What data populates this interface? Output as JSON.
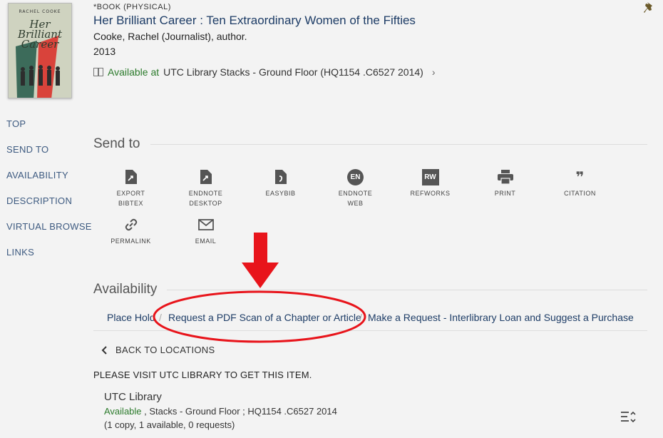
{
  "record": {
    "type": "*BOOK (PHYSICAL)",
    "title": "Her Brilliant Career : Ten Extraordinary Women of the Fifties",
    "author": "Cooke, Rachel (Journalist), author.",
    "year": "2013",
    "availability": {
      "status": "Available at",
      "location": "UTC Library  Stacks - Ground Floor (HQ1154 .C6527 2014)",
      "chevron": "›"
    },
    "cover": {
      "author": "RACHEL COOKE",
      "title": "Her Brilliant Career"
    }
  },
  "sidenav": [
    "TOP",
    "SEND TO",
    "AVAILABILITY",
    "DESCRIPTION",
    "VIRTUAL BROWSE",
    "LINKS"
  ],
  "send_to": {
    "heading": "Send to",
    "items": [
      {
        "label1": "EXPORT",
        "label2": "BIBTEX",
        "icon": "export-file-icon"
      },
      {
        "label1": "ENDNOTE",
        "label2": "DESKTOP",
        "icon": "export-file-icon"
      },
      {
        "label1": "EASYBIB",
        "label2": "",
        "icon": "easybib-file-icon"
      },
      {
        "label1": "ENDNOTE",
        "label2": "WEB",
        "icon": "endnote-web-icon",
        "badge": "EN"
      },
      {
        "label1": "REFWORKS",
        "label2": "",
        "icon": "refworks-icon",
        "badge": "RW"
      },
      {
        "label1": "PRINT",
        "label2": "",
        "icon": "printer-icon"
      },
      {
        "label1": "CITATION",
        "label2": "",
        "icon": "quote-icon",
        "glyph": "❞"
      },
      {
        "label1": "PERMALINK",
        "label2": "",
        "icon": "link-icon"
      },
      {
        "label1": "EMAIL",
        "label2": "",
        "icon": "envelope-icon"
      }
    ]
  },
  "availability": {
    "heading": "Availability",
    "tabs": {
      "place_hold": "Place Hold",
      "separator": "/",
      "request_pdf": "Request a PDF Scan of a Chapter or Article",
      "ill": "Make a Request - Interlibrary Loan and Suggest a Purchase"
    },
    "back_label": "BACK TO LOCATIONS",
    "visit_note": "PLEASE VISIT UTC LIBRARY TO GET THIS ITEM.",
    "location": {
      "name": "UTC Library",
      "status": "Available",
      "details": " , Stacks - Ground Floor ; HQ1154 .C6527 2014",
      "copies": "(1 copy, 1 available, 0 requests)"
    }
  },
  "colors": {
    "link": "#1d3c66",
    "available": "#2b7a2b",
    "annotation": "#e8141b"
  }
}
